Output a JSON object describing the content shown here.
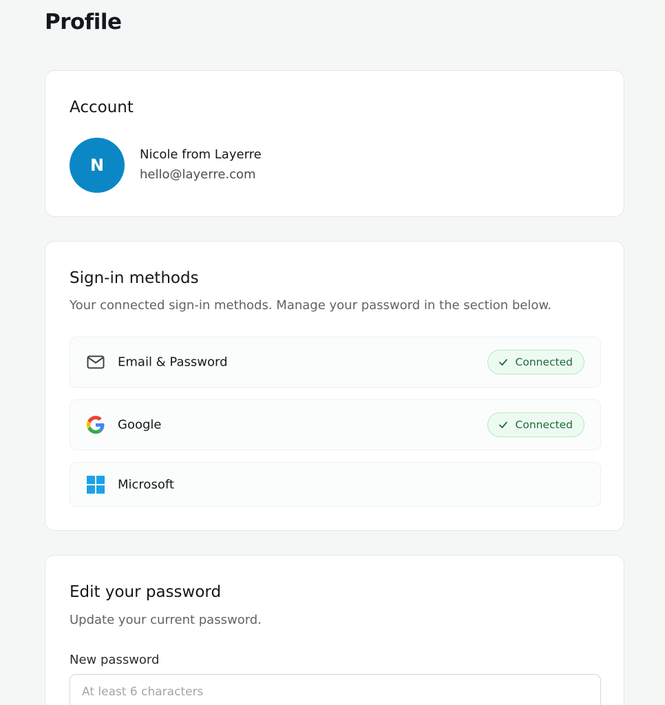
{
  "page": {
    "title": "Profile"
  },
  "account": {
    "heading": "Account",
    "avatar_initial": "N",
    "avatar_color": "#0b87c6",
    "name": "Nicole from Layerre",
    "email": "hello@layerre.com"
  },
  "signin": {
    "heading": "Sign-in methods",
    "description": "Your connected sign-in methods. Manage your password in the section below.",
    "methods": [
      {
        "icon": "mail-icon",
        "label": "Email & Password",
        "status": "Connected"
      },
      {
        "icon": "google-icon",
        "label": "Google",
        "status": "Connected"
      },
      {
        "icon": "microsoft-icon",
        "label": "Microsoft",
        "status": ""
      }
    ],
    "status_color": "#1d6b37"
  },
  "password": {
    "heading": "Edit your password",
    "description": "Update your current password.",
    "new_label": "New password",
    "new_placeholder": "At least 6 characters",
    "new_value": ""
  }
}
